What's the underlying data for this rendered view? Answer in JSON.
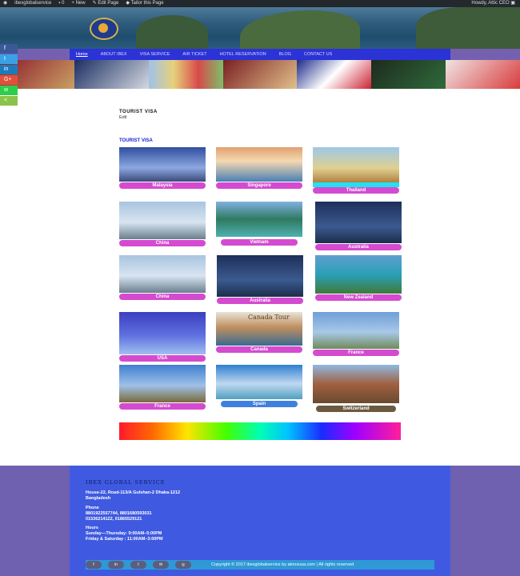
{
  "admin_bar": {
    "site": "ibexglobalservice",
    "comments": "0",
    "new": "New",
    "edit_page": "Edit Page",
    "tailor": "Tailor this Page",
    "howdy": "Howdy, Attic CEO"
  },
  "nav": {
    "items": [
      "Home",
      "ABOUT IBEX",
      "VISA SERVICE",
      "AIR TICKET",
      "HOTEL RESERVATION",
      "BLOG",
      "CONTACT US"
    ]
  },
  "social_sidebar": [
    "f",
    "t",
    "in",
    "G+",
    "w",
    "<"
  ],
  "page": {
    "title": "TOURIST VISA",
    "edit": "Edit",
    "subtitle": "TOURIST VISA"
  },
  "tiles": [
    {
      "label": "Malaysia",
      "color": "#d44bd0"
    },
    {
      "label": "Singapore",
      "color": "#d44bd0"
    },
    {
      "label": "Thailand",
      "color": "#d44bd0"
    },
    {
      "label": "China",
      "color": "#d44bd0"
    },
    {
      "label": "Vietnam",
      "color": "#d44bd0"
    },
    {
      "label": "Australia",
      "color": "#d44bd0"
    },
    {
      "label": "China",
      "color": "#d44bd0"
    },
    {
      "label": "Australia",
      "color": "#d44bd0"
    },
    {
      "label": "New Zealand",
      "color": "#d44bd0"
    },
    {
      "label": "USA",
      "color": "#d44bd0"
    },
    {
      "label": "Canada",
      "color": "#d44bd0"
    },
    {
      "label": "France",
      "color": "#d44bd0"
    },
    {
      "label": "France",
      "color": "#d44bd0"
    },
    {
      "label": "Spain",
      "color": "#3f7fe0"
    },
    {
      "label": "Switzerland",
      "color": "#6b5a40"
    }
  ],
  "canada_banner": "Canada Tour",
  "footer": {
    "brand": "IBEX GLOBAL SERVICE",
    "address1": "House-22, Road-113/A Gulshan-2 Dhaka-1212",
    "address2": "Bangladesh",
    "phone_label": "Phone",
    "phone1": "8801922557744, 8801680593031",
    "phone2": "01536214122, 01865529121",
    "hours_label": "Hours",
    "hours1": "Sunday—Thursday: 9:00AM–5:00PM",
    "hours2": "Friday & Saturday : 11:00AM–3:00PM",
    "copyright": "Copyright © 2017 ibexglobalservice by abroxusa.com | All rights reserved",
    "buttons": [
      "f",
      "in",
      "t",
      "✉",
      "◎"
    ]
  }
}
